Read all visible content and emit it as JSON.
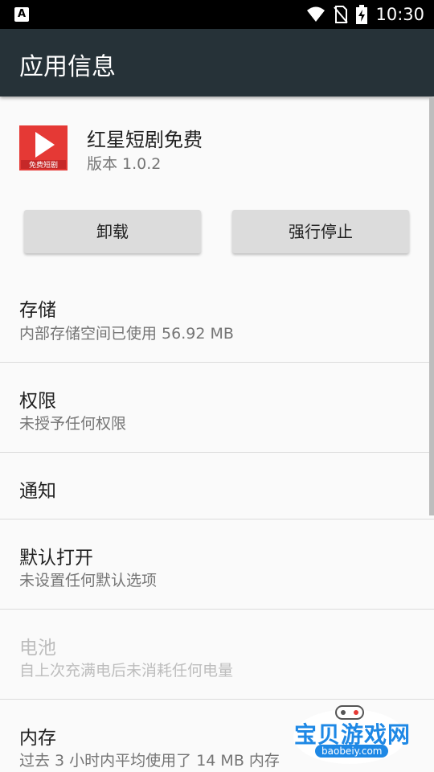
{
  "status_bar": {
    "time": "10:30",
    "icons": [
      "notification-a-icon",
      "wifi-icon",
      "no-sim-icon",
      "battery-charging-icon"
    ]
  },
  "app_bar": {
    "title": "应用信息"
  },
  "app": {
    "logo_label": "免费短剧",
    "name": "红星短剧免费",
    "version": "版本 1.0.2"
  },
  "buttons": {
    "uninstall": "卸载",
    "force_stop": "强行停止"
  },
  "prefs": [
    {
      "title": "存储",
      "subtitle": "内部存储空间已使用 56.92 MB",
      "enabled": true
    },
    {
      "title": "权限",
      "subtitle": "未授予任何权限",
      "enabled": true
    },
    {
      "title": "通知",
      "subtitle": "",
      "enabled": true
    },
    {
      "title": "默认打开",
      "subtitle": "未设置任何默认选项",
      "enabled": true
    },
    {
      "title": "电池",
      "subtitle": "自上次充满电后未消耗任何电量",
      "enabled": false
    },
    {
      "title": "内存",
      "subtitle": "过去 3 小时内平均使用了 14 MB 内存",
      "enabled": true
    }
  ],
  "watermark": {
    "text": "宝贝游戏网",
    "sub": "baobeiy.com"
  },
  "colors": {
    "app_bar": "#263238",
    "brand_red": "#e53935",
    "watermark_blue": "#1e88e5"
  }
}
